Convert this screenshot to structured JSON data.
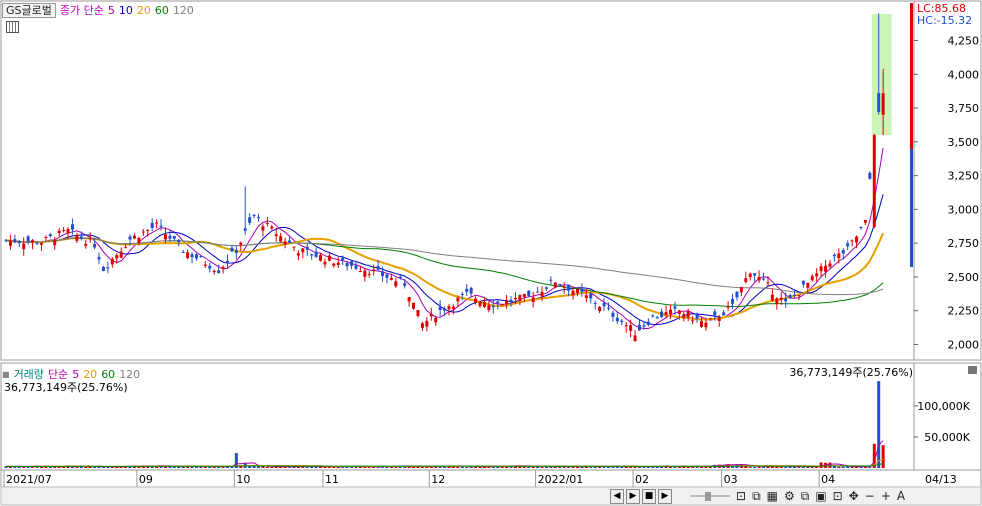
{
  "symbol": "GS글로벌",
  "price_legend": {
    "label": "종가 단순",
    "periods": [
      "5",
      "10",
      "20",
      "60",
      "120"
    ],
    "colors": [
      "#b000b0",
      "#0000c0",
      "#e6a000",
      "#008000",
      "#808080"
    ]
  },
  "volume_legend": {
    "label": "거래량",
    "label2": "단순",
    "periods": [
      "5",
      "20",
      "60",
      "120"
    ],
    "colors": [
      "#b000b0",
      "#e6a000",
      "#008000",
      "#808080"
    ]
  },
  "lc_label": "LC:85.68",
  "hc_label": "HC:-15.32",
  "volume_left_label": "36,773,149주(25.76%)",
  "volume_right_label": "36,773,149주(25.76%)",
  "x_ticks": [
    {
      "label": "2021/07",
      "i": 0
    },
    {
      "label": "09",
      "i": 30
    },
    {
      "label": "10",
      "i": 52
    },
    {
      "label": "11",
      "i": 72
    },
    {
      "label": "12",
      "i": 96
    },
    {
      "label": "2022/01",
      "i": 120
    },
    {
      "label": "02",
      "i": 142
    },
    {
      "label": "03",
      "i": 162
    },
    {
      "label": "04",
      "i": 184
    }
  ],
  "x_end_label": "04/13",
  "chart_data": {
    "type": "candlestick",
    "price_axis": {
      "ticks": [
        2000,
        2250,
        2500,
        2750,
        3000,
        3250,
        3500,
        3750,
        4000,
        4250
      ],
      "ylim": [
        1900,
        4520
      ]
    },
    "volume_axis": {
      "ticks": [
        "50,000K",
        "100,000K"
      ],
      "tick_values": [
        50000,
        100000
      ],
      "ylim": [
        0,
        145000
      ]
    },
    "candles": [],
    "volume": []
  }
}
